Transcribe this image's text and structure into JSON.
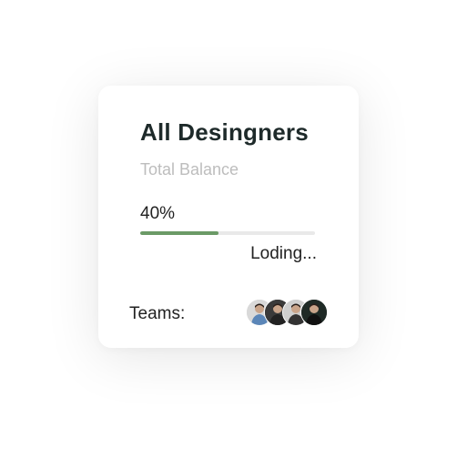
{
  "card": {
    "title": "All Desingners",
    "subtitle": "Total Balance",
    "progress": {
      "label": "40%",
      "value": 0.45,
      "color": "#6b9a66"
    },
    "status": "Loding...",
    "teams_label": "Teams:",
    "team_members": [
      {
        "icon": "person-avatar",
        "bg": "#d9d9d9",
        "shirt": "#5b86b8"
      },
      {
        "icon": "person-avatar",
        "bg": "#3a3a3a",
        "shirt": "#222222"
      },
      {
        "icon": "person-avatar",
        "bg": "#cfcfcf",
        "shirt": "#333333"
      },
      {
        "icon": "person-avatar",
        "bg": "#1f2a26",
        "shirt": "#111111"
      }
    ]
  }
}
